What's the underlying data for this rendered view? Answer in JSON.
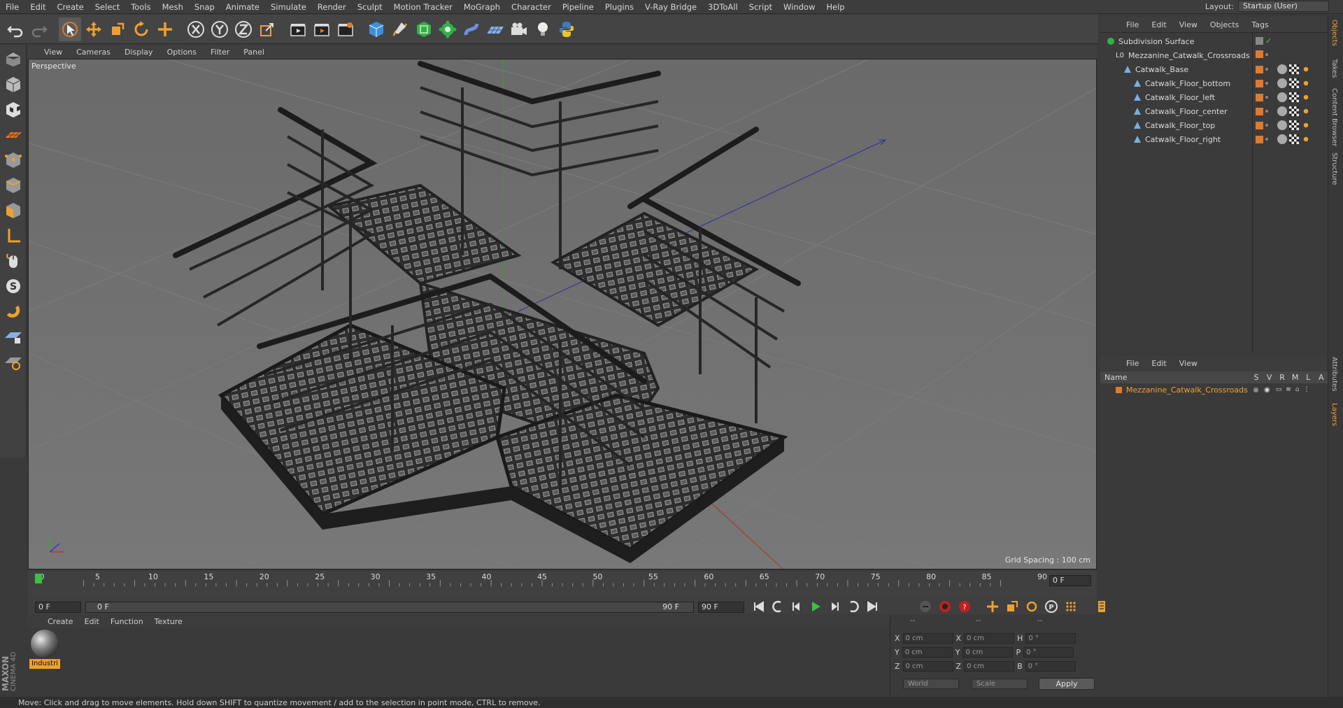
{
  "menubar": {
    "items": [
      "File",
      "Edit",
      "Create",
      "Select",
      "Tools",
      "Mesh",
      "Snap",
      "Animate",
      "Simulate",
      "Render",
      "Sculpt",
      "Motion Tracker",
      "MoGraph",
      "Character",
      "Pipeline",
      "Plugins",
      "V-Ray Bridge",
      "3DToAll",
      "Script",
      "Window",
      "Help"
    ],
    "layout_label": "Layout:",
    "layout_value": "Startup (User)"
  },
  "viewport": {
    "menu": [
      "View",
      "Cameras",
      "Display",
      "Options",
      "Filter",
      "Panel"
    ],
    "label": "Perspective",
    "grid_spacing": "Grid Spacing : 100 cm"
  },
  "object_manager": {
    "menu": [
      "File",
      "Edit",
      "View",
      "Objects",
      "Tags"
    ],
    "objects": [
      {
        "name": "Subdivision Surface",
        "indent": 0
      },
      {
        "name": "Mezzanine_Catwalk_Crossroads",
        "indent": 1
      },
      {
        "name": "Catwalk_Base",
        "indent": 2
      },
      {
        "name": "Catwalk_Floor_bottom",
        "indent": 3
      },
      {
        "name": "Catwalk_Floor_left",
        "indent": 3
      },
      {
        "name": "Catwalk_Floor_center",
        "indent": 3
      },
      {
        "name": "Catwalk_Floor_top",
        "indent": 3
      },
      {
        "name": "Catwalk_Floor_right",
        "indent": 3
      }
    ]
  },
  "side_tabs": [
    "Objects",
    "Takes",
    "Content Browser",
    "Structure",
    "Attributes",
    "Layers"
  ],
  "layers": {
    "menu": [
      "File",
      "Edit",
      "View"
    ],
    "columns": [
      "Name",
      "S",
      "V",
      "R",
      "M",
      "L",
      "A"
    ],
    "rows": [
      {
        "name": "Mezzanine_Catwalk_Crossroads",
        "color": "#e07a2d"
      }
    ]
  },
  "timeline": {
    "ticks": [
      "0",
      "5",
      "10",
      "15",
      "20",
      "25",
      "30",
      "35",
      "40",
      "45",
      "50",
      "55",
      "60",
      "65",
      "70",
      "75",
      "80",
      "85",
      "90"
    ],
    "end_frame": "0 F",
    "current_frame": "0 F",
    "range_start": "0 F",
    "range_end_inner": "90 F",
    "range_end": "90 F"
  },
  "material_manager": {
    "menu": [
      "Create",
      "Edit",
      "Function",
      "Texture"
    ],
    "materials": [
      {
        "name": "Industri"
      }
    ]
  },
  "coordinates": {
    "headers": [
      "--",
      "--",
      "--"
    ],
    "rows": [
      {
        "a": "X",
        "av": "0 cm",
        "b": "X",
        "bv": "0 cm",
        "c": "H",
        "cv": "0 °"
      },
      {
        "a": "Y",
        "av": "0 cm",
        "b": "Y",
        "bv": "0 cm",
        "c": "P",
        "cv": "0 °"
      },
      {
        "a": "Z",
        "av": "0 cm",
        "b": "Z",
        "bv": "0 cm",
        "c": "B",
        "cv": "0 °"
      }
    ],
    "world": "World",
    "scale": "Scale",
    "apply": "Apply"
  },
  "status": "Move: Click and drag to move elements. Hold down SHIFT to quantize movement / add to the selection in point mode, CTRL to remove.",
  "brand": {
    "maxon": "MAXON",
    "c4d": "CINEMA 4D"
  },
  "colors": {
    "accent": "#e07a2d",
    "highlight": "#f0a030",
    "bg": "#3a3a3a"
  }
}
